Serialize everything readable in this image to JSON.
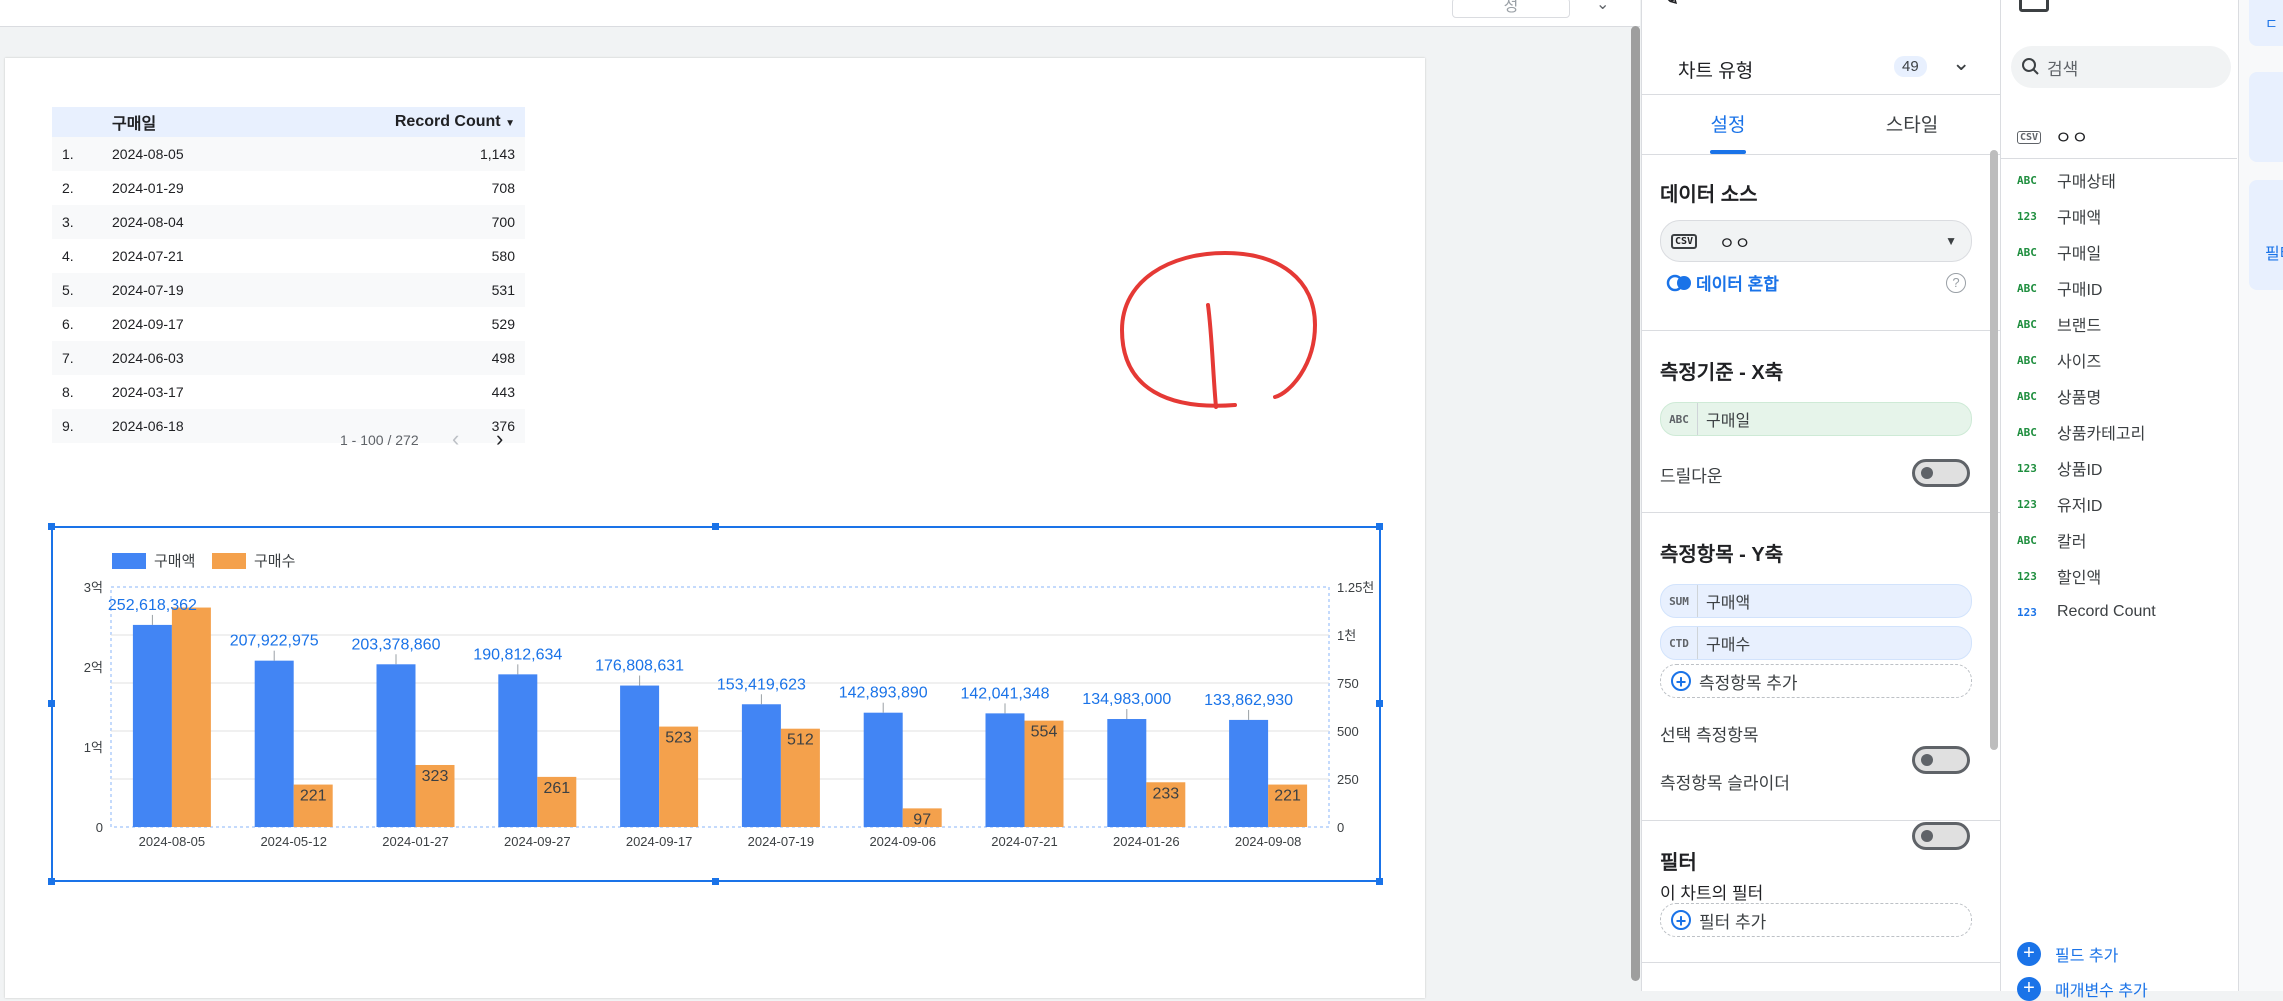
{
  "topbar": {
    "button_label": "성",
    "chevron": "chevron-down-icon"
  },
  "table": {
    "headers": {
      "date": "구매일",
      "count": "Record Count",
      "sort_indicator": "▼"
    },
    "rows": [
      {
        "idx": "1.",
        "date": "2024-08-05",
        "value": "1,143"
      },
      {
        "idx": "2.",
        "date": "2024-01-29",
        "value": "708"
      },
      {
        "idx": "3.",
        "date": "2024-08-04",
        "value": "700"
      },
      {
        "idx": "4.",
        "date": "2024-07-21",
        "value": "580"
      },
      {
        "idx": "5.",
        "date": "2024-07-19",
        "value": "531"
      },
      {
        "idx": "6.",
        "date": "2024-09-17",
        "value": "529"
      },
      {
        "idx": "7.",
        "date": "2024-06-03",
        "value": "498"
      },
      {
        "idx": "8.",
        "date": "2024-03-17",
        "value": "443"
      },
      {
        "idx": "9.",
        "date": "2024-06-18",
        "value": "376"
      }
    ],
    "pager": "1 - 100 / 272"
  },
  "chart_data": {
    "type": "bar",
    "categories": [
      "2024-08-05",
      "2024-05-12",
      "2024-01-27",
      "2024-09-27",
      "2024-09-17",
      "2024-07-19",
      "2024-09-06",
      "2024-07-21",
      "2024-01-26",
      "2024-09-08"
    ],
    "series": [
      {
        "name": "구매액",
        "axis": "left",
        "color": "#4285f4",
        "values": [
          252618362,
          207922975,
          203378860,
          190812634,
          176808631,
          153419623,
          142893890,
          142041348,
          134983000,
          133862930
        ],
        "labels": [
          "252,618,362",
          "207,922,975",
          "203,378,860",
          "190,812,634",
          "176,808,631",
          "153,419,623",
          "142,893,890",
          "142,041,348",
          "134,983,000",
          "133,862,930"
        ]
      },
      {
        "name": "구매수",
        "axis": "right",
        "color": "#f4a14c",
        "values": [
          1143,
          221,
          323,
          261,
          523,
          512,
          97,
          554,
          233,
          221
        ],
        "labels": [
          "",
          "221",
          "323",
          "261",
          "523",
          "512",
          "97",
          "554",
          "233",
          "221"
        ]
      }
    ],
    "left_axis": {
      "ticks": [
        "0",
        "1억",
        "2억",
        "3억"
      ],
      "max": 300000000
    },
    "right_axis": {
      "ticks": [
        "0",
        "250",
        "500",
        "750",
        "1천",
        "1.25천"
      ],
      "max": 1250
    },
    "legend_position": "top-left",
    "grid": true
  },
  "panel1": {
    "header_label": "차트 유형",
    "chart_count": "49",
    "tabs": {
      "setup": "설정",
      "style": "스타일"
    },
    "data_source": {
      "title": "데이터 소스",
      "source_tag": "CSV",
      "source_name": "ㅇㅇ",
      "blend_label": "데이터 혼합"
    },
    "dimension": {
      "title": "측정기준 - X축",
      "tag": "ABC",
      "field": "구매일",
      "drilldown": "드릴다운"
    },
    "metric": {
      "title": "측정항목 - Y축",
      "items": [
        {
          "tag": "SUM",
          "field": "구매액"
        },
        {
          "tag": "CTD",
          "field": "구매수"
        }
      ],
      "add_label": "측정항목 추가",
      "optional_label": "선택 측정항목",
      "slider_label": "측정항목 슬라이더"
    },
    "filter": {
      "title": "필터",
      "subtitle": "이 차트의 필터",
      "add_label": "필터 추가"
    }
  },
  "panel2": {
    "search_placeholder": "검색",
    "source_tag": "CSV",
    "source_name": "ㅇㅇ",
    "fields": [
      {
        "tag": "ABC",
        "type": "dim",
        "name": "구매상태"
      },
      {
        "tag": "123",
        "type": "num",
        "name": "구매액"
      },
      {
        "tag": "ABC",
        "type": "dim",
        "name": "구매일"
      },
      {
        "tag": "ABC",
        "type": "dim",
        "name": "구매ID"
      },
      {
        "tag": "ABC",
        "type": "dim",
        "name": "브랜드"
      },
      {
        "tag": "ABC",
        "type": "dim",
        "name": "사이즈"
      },
      {
        "tag": "ABC",
        "type": "dim",
        "name": "상품명"
      },
      {
        "tag": "ABC",
        "type": "dim",
        "name": "상품카테고리"
      },
      {
        "tag": "123",
        "type": "num",
        "name": "상품ID"
      },
      {
        "tag": "123",
        "type": "num",
        "name": "유저ID"
      },
      {
        "tag": "ABC",
        "type": "dim",
        "name": "칼러"
      },
      {
        "tag": "123",
        "type": "num",
        "name": "할인액"
      },
      {
        "tag": "123",
        "type": "met",
        "name": "Record Count"
      }
    ],
    "add_field": "필드 추가",
    "add_param": "매개변수 추가"
  },
  "panel3": {
    "tab_label": "필터"
  }
}
